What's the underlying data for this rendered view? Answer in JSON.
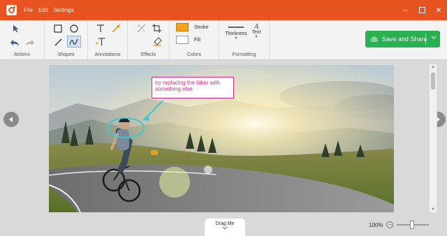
{
  "menu": [
    "File",
    "Edit",
    "Settings"
  ],
  "ribbon": {
    "groups": {
      "actions": "Actions",
      "shapes": "Shapes",
      "annotations": "Annotations",
      "effects": "Effects",
      "colors": "Colors",
      "formatting": "Formatting"
    },
    "stroke_label": "Stroke",
    "fill_label": "Fill",
    "stroke_color": "#f7a21b",
    "fill_color": "#ffffff",
    "thickness_label": "Thickness",
    "text_label": "Text"
  },
  "save_button": {
    "label": "Save and Share",
    "color": "#28b051"
  },
  "annotation": {
    "text": "try replacing the biker with something else",
    "color": "#d42c8e",
    "ellipse_color": "#41c7d3"
  },
  "drag_label": "Drag Me",
  "zoom": {
    "value_label": "100%",
    "level": 0.5
  },
  "titlebar_color": "#e8531f",
  "icons": [
    "app-logo-icon",
    "minimize-icon",
    "maximize-icon",
    "close-icon",
    "pointer-icon",
    "undo-icon",
    "redo-icon",
    "rectangle-icon",
    "ellipse-icon",
    "line-icon",
    "freehand-icon",
    "text-tool-icon",
    "arrow-tool-icon",
    "resize-text-icon",
    "blur-icon",
    "crop-icon",
    "eraser-icon",
    "line-thickness-icon",
    "text-style-icon",
    "cloud-upload-icon",
    "chevron-down-icon",
    "chevron-left-icon",
    "chevron-right-icon"
  ]
}
